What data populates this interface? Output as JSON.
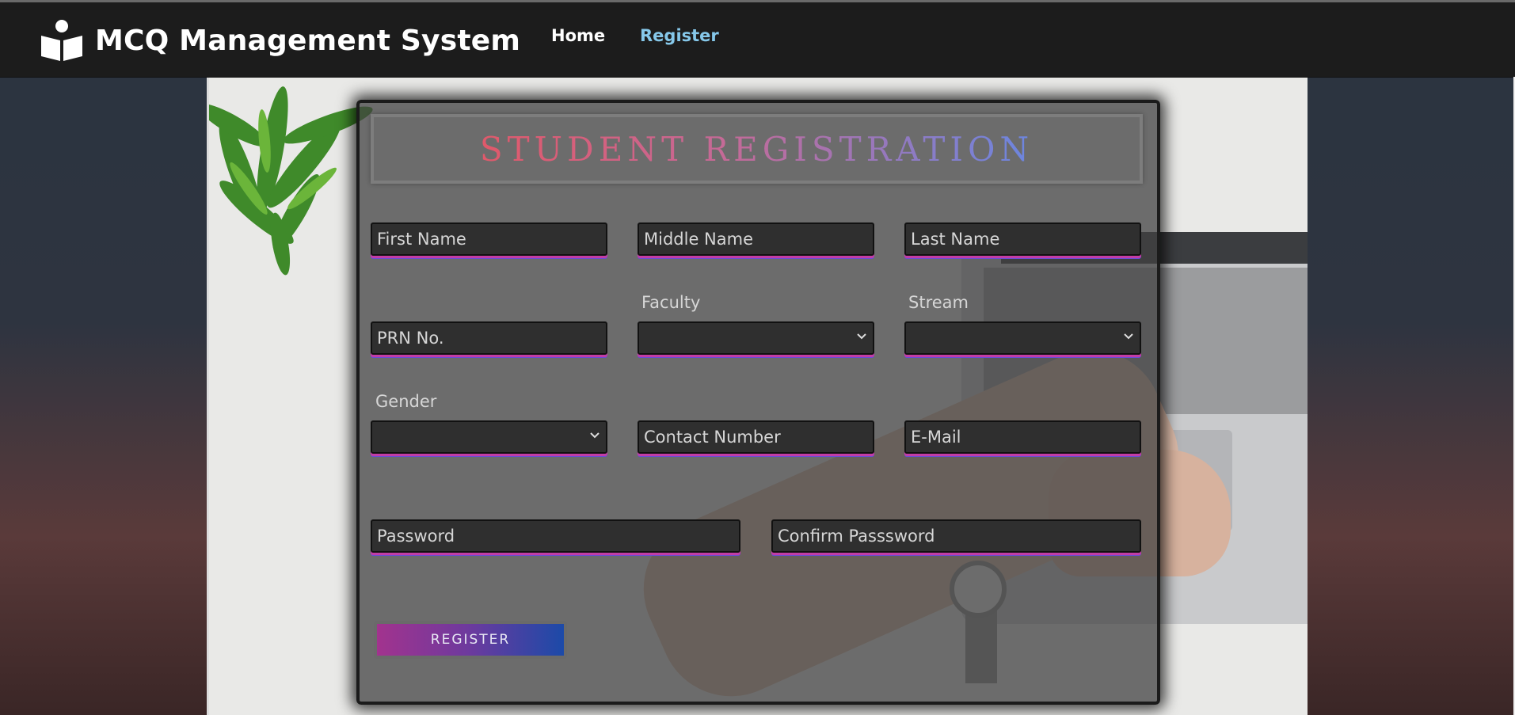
{
  "navbar": {
    "brand_title": "MCQ Management System",
    "links": [
      {
        "label": "Home",
        "color": "#ffffff"
      },
      {
        "label": "Register",
        "color": "#86c8ea"
      }
    ]
  },
  "form": {
    "title": "STUDENT REGISTRATION",
    "fields": {
      "first_name": {
        "placeholder": "First Name",
        "value": ""
      },
      "middle_name": {
        "placeholder": "Middle Name",
        "value": ""
      },
      "last_name": {
        "placeholder": "Last Name",
        "value": ""
      },
      "prn": {
        "placeholder": "PRN No.",
        "value": ""
      },
      "faculty": {
        "label": "Faculty",
        "selected": ""
      },
      "stream": {
        "label": "Stream",
        "selected": ""
      },
      "gender": {
        "label": "Gender",
        "selected": ""
      },
      "contact": {
        "placeholder": "Contact Number",
        "value": ""
      },
      "email": {
        "placeholder": "E-Mail",
        "value": ""
      },
      "password": {
        "placeholder": "Password",
        "value": ""
      },
      "confirm_password": {
        "placeholder": "Confirm Passsword",
        "value": ""
      }
    },
    "submit_label": "REGISTER"
  },
  "colors": {
    "navbar_bg": "#1c1c1c",
    "field_underline_start": "#c23ca6",
    "field_underline_end": "#6b4cd6",
    "button_gradient_start": "#a2338e",
    "button_gradient_end": "#1c4aa8"
  },
  "icons": {
    "brand": "reader-book-icon",
    "select": "chevron-down-icon"
  }
}
